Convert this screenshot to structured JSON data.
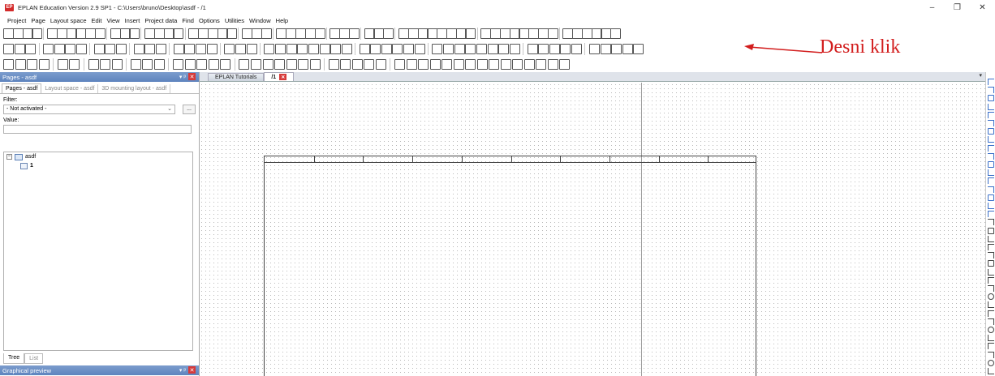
{
  "window": {
    "title": "EPLAN Education Version 2.9 SP1 - C:\\Users\\bruno\\Desktop\\asdf - /1",
    "logo_text": "EP",
    "minimize": "–",
    "maximize": "❐",
    "close": "✕"
  },
  "menu": [
    "Project",
    "Page",
    "Layout space",
    "Edit",
    "View",
    "Insert",
    "Project data",
    "Find",
    "Options",
    "Utilities",
    "Window",
    "Help"
  ],
  "annotation": {
    "text": "Desni klik",
    "color": "#d21d1d"
  },
  "pages_panel": {
    "header": "Pages - asdf",
    "pin": "▾ ᵖ",
    "close": "✕",
    "tabs": [
      "Pages - asdf",
      "Layout space - asdf",
      "3D mounting layout - asdf"
    ],
    "filter_label": "Filter:",
    "filter_value": "- Not activated -",
    "filter_button": "...",
    "value_label": "Value:",
    "tree": {
      "project": "asdf",
      "page": "1"
    },
    "bottom_tabs": [
      "Tree",
      "List"
    ]
  },
  "preview_panel": {
    "header": "Graphical preview",
    "pin": "▾ ᵖ",
    "close": "✕"
  },
  "doc_tabs": {
    "tutorials": "EPLAN Tutorials",
    "active": "/1",
    "close": "✕",
    "dropdown": "▾"
  },
  "colors": {
    "panel_header": "#6a8cc4",
    "close_red": "#d63a3a",
    "accent_red": "#d21d1d"
  }
}
